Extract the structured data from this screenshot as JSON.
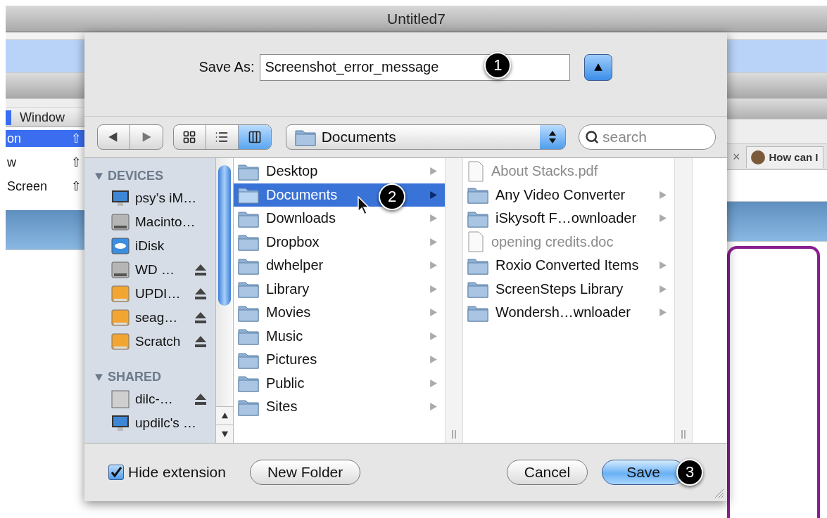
{
  "window": {
    "title": "Untitled7"
  },
  "background": {
    "menu_bar": [
      {
        "label": "Window",
        "selected": false
      }
    ],
    "menu_items": [
      {
        "label": "on",
        "shortcut": "⇧",
        "selected": true
      },
      {
        "label": "w",
        "shortcut": "⇧",
        "selected": false
      },
      {
        "label": "Screen",
        "shortcut": "⇧",
        "selected": false
      }
    ],
    "tab": {
      "label": "How can I",
      "close": "×"
    }
  },
  "dialog": {
    "save_as": {
      "label": "Save As:",
      "value": "Screenshot_error_message",
      "callout": "1",
      "expanded": true
    },
    "view_modes": [
      {
        "kind": "icons",
        "selected": false
      },
      {
        "kind": "list",
        "selected": false
      },
      {
        "kind": "columns",
        "selected": true
      }
    ],
    "location": "Documents",
    "search": {
      "placeholder": "search"
    },
    "sidebar": [
      {
        "heading": "DEVICES",
        "items": [
          {
            "name": "psy’s iM…",
            "kind": "computer",
            "eject": false
          },
          {
            "name": "Macinto…",
            "kind": "drive",
            "eject": false
          },
          {
            "name": "iDisk",
            "kind": "idisk",
            "eject": false
          },
          {
            "name": "WD …",
            "kind": "drive",
            "eject": true
          },
          {
            "name": "UPDI…",
            "kind": "usb",
            "eject": true
          },
          {
            "name": "seag…",
            "kind": "usb",
            "eject": true
          },
          {
            "name": "Scratch",
            "kind": "usb",
            "eject": true
          }
        ]
      },
      {
        "heading": "SHARED",
        "items": [
          {
            "name": "dilc-…",
            "kind": "server",
            "eject": true
          },
          {
            "name": "updilc's …",
            "kind": "computer",
            "eject": false
          }
        ]
      }
    ],
    "column_1": [
      {
        "name": "Desktop",
        "selected": false
      },
      {
        "name": "Documents",
        "selected": true,
        "callout": "2"
      },
      {
        "name": "Downloads",
        "selected": false
      },
      {
        "name": "Dropbox",
        "selected": false
      },
      {
        "name": "dwhelper",
        "selected": false
      },
      {
        "name": "Library",
        "selected": false
      },
      {
        "name": "Movies",
        "selected": false
      },
      {
        "name": "Music",
        "selected": false
      },
      {
        "name": "Pictures",
        "selected": false
      },
      {
        "name": "Public",
        "selected": false
      },
      {
        "name": "Sites",
        "selected": false
      }
    ],
    "column_2": [
      {
        "name": "About Stacks.pdf",
        "kind": "file"
      },
      {
        "name": "Any Video Converter",
        "kind": "folder"
      },
      {
        "name": "iSkysoft F…ownloader",
        "kind": "folder"
      },
      {
        "name": "opening credits.doc",
        "kind": "file"
      },
      {
        "name": "Roxio Converted Items",
        "kind": "folder"
      },
      {
        "name": "ScreenSteps Library",
        "kind": "folder"
      },
      {
        "name": "Wondersh…wnloader",
        "kind": "folder"
      }
    ],
    "hide_extension": {
      "label": "Hide extension",
      "checked": true
    },
    "buttons": [
      {
        "label": "New Folder",
        "kind": "secondary"
      },
      {
        "label": "Cancel",
        "kind": "normal"
      },
      {
        "label": "Save",
        "kind": "default",
        "callout": "3"
      }
    ]
  }
}
